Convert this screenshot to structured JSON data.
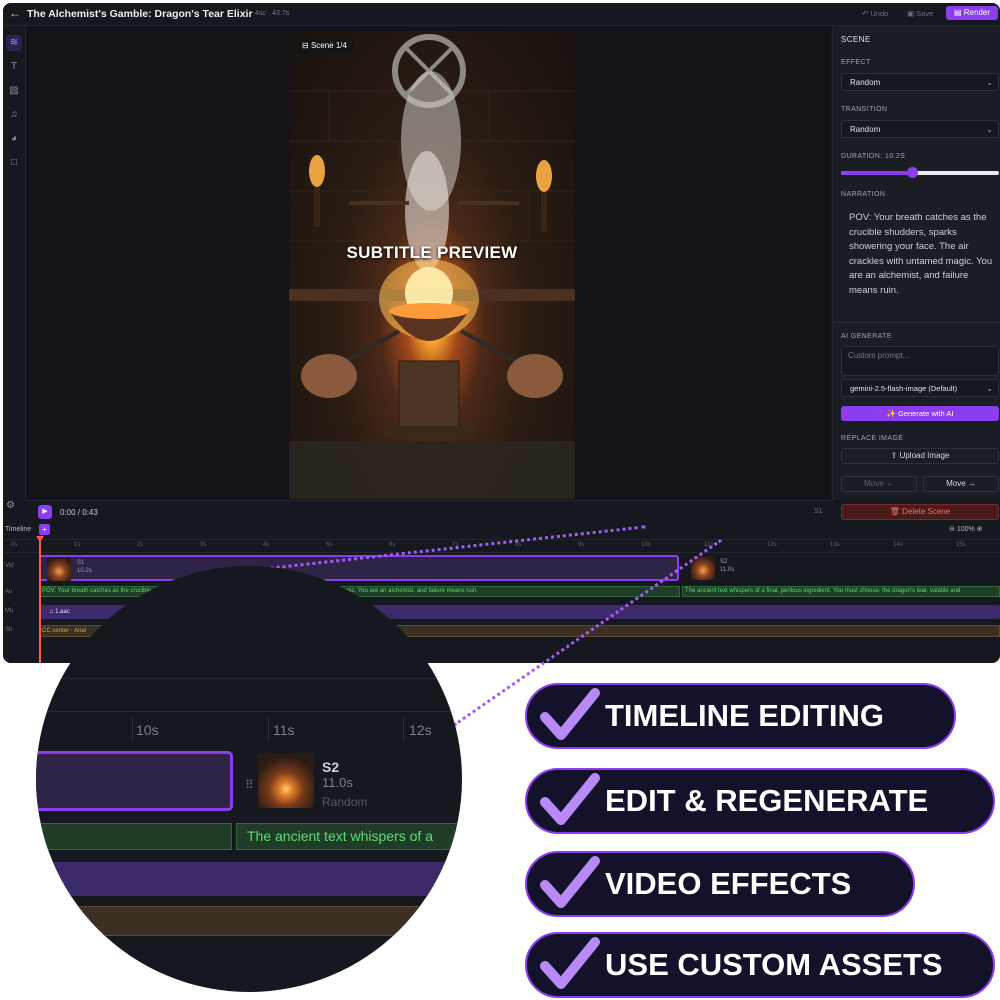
{
  "header": {
    "back_glyph": "←",
    "title": "The Alchemist's Gamble: Dragon's Tear Elixir",
    "meta": "4sc · 43.7s",
    "undo_label": "Undo",
    "save_label": "Save",
    "render_label": "Render"
  },
  "preview": {
    "scene_badge": "Scene 1/4",
    "subtitle_preview": "SUBTITLE PREVIEW"
  },
  "scene_panel": {
    "heading": "SCENE",
    "effect_label": "EFFECT",
    "effect_value": "Random",
    "transition_label": "TRANSITION",
    "transition_value": "Random",
    "duration_label": "DURATION: 10.2S",
    "duration_fraction": 0.45,
    "narration_label": "NARRATION",
    "narration_text": "POV: Your breath catches as the crucible shudders, sparks showering your face. The air crackles with untamed magic. You are an alchemist, and failure means ruin.",
    "ai_generate_label": "AI GENERATE",
    "prompt_placeholder": "Custom prompt...",
    "model_value": "gemini-2.5-flash-image (Default)",
    "generate_button": "Generate with AI",
    "replace_image_label": "REPLACE IMAGE",
    "upload_button": "Upload Image",
    "move_left_button": "Move ←",
    "move_right_button": "Move →",
    "delete_button": "Delete Scene"
  },
  "player": {
    "time": "0:00 / 0:43",
    "scene_indicator": "S1"
  },
  "timeline": {
    "label": "Timeline",
    "add_glyph": "+",
    "zoom": "100%",
    "ticks": [
      "0s",
      "1s",
      "2s",
      "3s",
      "4s",
      "5s",
      "6s",
      "7s",
      "8s",
      "9s",
      "10s",
      "11s",
      "12s",
      "13s",
      "14s",
      "15s"
    ],
    "track_labels": [
      "Vid",
      "Au",
      "Mu",
      "Sb"
    ],
    "video_clips": [
      {
        "name": "S1",
        "duration": "10.2s"
      },
      {
        "name": "S2",
        "duration": "11.0s"
      }
    ],
    "audio_clips": [
      "POV: Your breath catches as the crucible shudders, sparks showering your face. The air crackles with untamed magic. You are an alchemist, and failure means ruin.",
      "The ancient text whispers of a final, perilous ingredient. You must choose: the dragon's tear, volatile and"
    ],
    "music_clip": "1.aac",
    "subtitle_clip": "CC center · Arial"
  },
  "zoom_view": {
    "ticks": [
      "10s",
      "11s",
      "12s"
    ],
    "clip_name": "S2",
    "clip_duration": "11.0s",
    "clip_effect": "Random",
    "audio_text": "The ancient text whispers of a"
  },
  "features": [
    "TIMELINE EDITING",
    "EDIT & REGENERATE",
    "VIDEO EFFECTS",
    "USE CUSTOM ASSETS"
  ],
  "colors": {
    "accent": "#8b3df0",
    "background": "#16181f",
    "audio_green": "#5fdb78",
    "playhead": "#ff5a4a",
    "delete_red": "#f07070"
  }
}
